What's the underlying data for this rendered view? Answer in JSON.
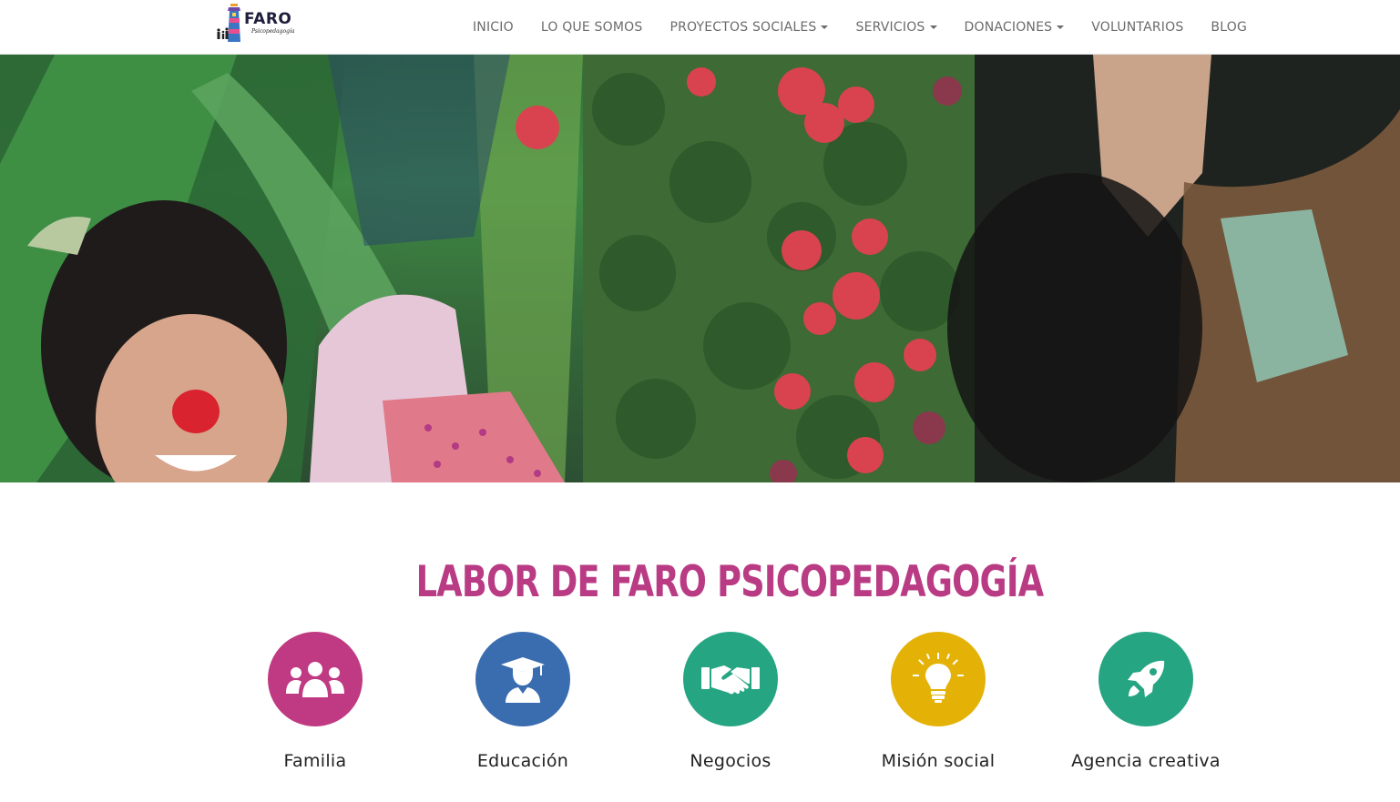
{
  "header": {
    "logo_text": "FARO",
    "logo_subtitle": "Psicopedagogía",
    "nav": [
      {
        "label": "INICIO",
        "dropdown": false
      },
      {
        "label": "LO QUE SOMOS",
        "dropdown": false
      },
      {
        "label": "PROYECTOS SOCIALES",
        "dropdown": true
      },
      {
        "label": "SERVICIOS",
        "dropdown": true
      },
      {
        "label": "DONACIONES",
        "dropdown": true
      },
      {
        "label": "VOLUNTARIOS",
        "dropdown": false
      },
      {
        "label": "BLOG",
        "dropdown": false
      }
    ]
  },
  "section": {
    "title": "LABOR DE FARO PSICOPEDAGOGÍA",
    "features": [
      {
        "label": "Familia",
        "icon": "users-icon",
        "color": "#bf3a82"
      },
      {
        "label": "Educación",
        "icon": "graduate-icon",
        "color": "#3a6db0"
      },
      {
        "label": "Negocios",
        "icon": "handshake-icon",
        "color": "#26a583"
      },
      {
        "label": "Misión social",
        "icon": "lightbulb-icon",
        "color": "#e4b206"
      },
      {
        "label": "Agencia creativa",
        "icon": "rocket-icon",
        "color": "#26a583"
      }
    ]
  },
  "colors": {
    "accent": "#b93b84",
    "nav_text": "#6b6b6b"
  }
}
